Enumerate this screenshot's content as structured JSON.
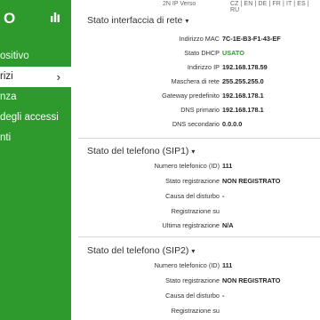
{
  "sidebar": {
    "logo": "O",
    "items": [
      {
        "label": "ositivo"
      },
      {
        "label": "rizi"
      },
      {
        "label": "nza"
      },
      {
        "label": "degli accessi"
      },
      {
        "label": "nti"
      }
    ],
    "active_index": 1
  },
  "topbar": {
    "version": "2N IP Verso",
    "languages": "CZ | EN | DE | FR | IT | ES | RU"
  },
  "sections": {
    "network": {
      "title": "Stato interfaccia di rete",
      "rows": [
        {
          "label": "Indirizzo MAC",
          "value": "7C-1E-B3-F1-43-EF"
        },
        {
          "label": "Stato DHCP",
          "value": "USATO"
        },
        {
          "label": "Indirizzo IP",
          "value": "192.168.178.59"
        },
        {
          "label": "Maschera di rete",
          "value": "255.255.255.0"
        },
        {
          "label": "Gateway predefinito",
          "value": "192.168.178.1"
        },
        {
          "label": "DNS primario",
          "value": "192.168.178.1"
        },
        {
          "label": "DNS secondario",
          "value": "0.0.0.0"
        }
      ]
    },
    "sip1": {
      "title": "Stato del telefono (SIP1)",
      "rows": [
        {
          "label": "Numero telefonico (ID)",
          "value": "111"
        },
        {
          "label": "Stato registrazione",
          "value": "NON REGISTRATO"
        },
        {
          "label": "Causa del disturbo",
          "value": "-"
        },
        {
          "label": "Registrazione su",
          "value": ""
        },
        {
          "label": "Ultima registrazione",
          "value": "N/A"
        }
      ]
    },
    "sip2": {
      "title": "Stato del telefono (SIP2)",
      "rows": [
        {
          "label": "Numero telefonico (ID)",
          "value": "111"
        },
        {
          "label": "Stato registrazione",
          "value": "NON REGISTRATO"
        },
        {
          "label": "Causa del disturbo",
          "value": "-"
        },
        {
          "label": "Registrazione su",
          "value": ""
        }
      ]
    }
  },
  "colors": {
    "accent": "#2e9a2e",
    "dhcp_status": "#2e9a2e"
  },
  "icons": {
    "stats": "bar-chart-icon",
    "section_caret": "chevron-down-icon",
    "nav_arrow": "chevron-right-icon"
  }
}
